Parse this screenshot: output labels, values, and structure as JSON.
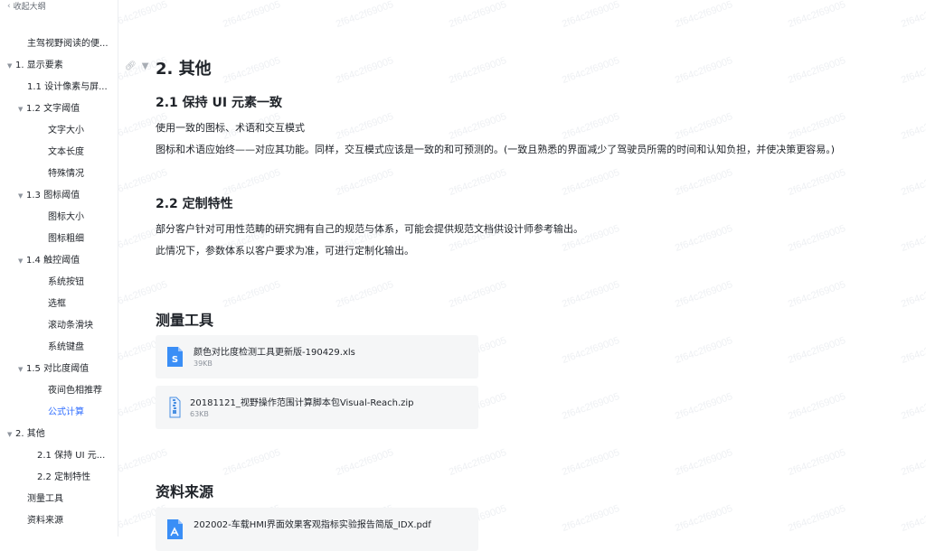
{
  "sidebar": {
    "collapse_label": "收起大纲",
    "toc": [
      {
        "label": "主驾视野阅读的便...",
        "active": false
      },
      {
        "label": "1. 显示要素",
        "active": false
      },
      {
        "label": "1.1 设计像素与屏...",
        "active": false
      },
      {
        "label": "1.2 文字阈值",
        "active": false
      },
      {
        "label": "文字大小",
        "active": false
      },
      {
        "label": "文本长度",
        "active": false
      },
      {
        "label": "特殊情况",
        "active": false
      },
      {
        "label": "1.3 图标阈值",
        "active": false
      },
      {
        "label": "图标大小",
        "active": false
      },
      {
        "label": "图标粗细",
        "active": false
      },
      {
        "label": "1.4 触控阈值",
        "active": false
      },
      {
        "label": "系统按钮",
        "active": false
      },
      {
        "label": "选框",
        "active": false
      },
      {
        "label": "滚动条滑块",
        "active": false
      },
      {
        "label": "系统键盘",
        "active": false
      },
      {
        "label": "1.5 对比度阈值",
        "active": false
      },
      {
        "label": "夜间色相推荐",
        "active": false
      },
      {
        "label": "公式计算",
        "active": true
      },
      {
        "label": "2. 其他",
        "active": false
      },
      {
        "label": "2.1 保持 UI 元...",
        "active": false
      },
      {
        "label": "2.2 定制特性",
        "active": false
      },
      {
        "label": "测量工具",
        "active": false
      },
      {
        "label": "资料来源",
        "active": false
      }
    ]
  },
  "watermark": "2f64c2f69005",
  "content": {
    "section_title": "2. 其他",
    "sub1": {
      "title": "2.1 保持 UI 元素一致",
      "p1": "使用一致的图标、术语和交互模式",
      "p2": "图标和术语应始终——对应其功能。同样，交互模式应该是一致的和可预测的。(一致且熟悉的界面减少了驾驶员所需的时间和认知负担，并使决策更容易。)"
    },
    "sub2": {
      "title": "2.2 定制特性",
      "p1": "部分客户针对可用性范畴的研究拥有自己的规范与体系，可能会提供规范文档供设计师参考输出。",
      "p2": "此情况下，参数体系以客户要求为准，可进行定制化输出。"
    },
    "tools": {
      "title": "测量工具",
      "files": [
        {
          "name": "颜色对比度检测工具更新版-190429.xls",
          "size": "39KB",
          "icon": "spreadsheet-icon"
        },
        {
          "name": "20181121_视野操作范围计算脚本包Visual-Reach.zip",
          "size": "63KB",
          "icon": "zip-icon"
        }
      ]
    },
    "sources": {
      "title": "资料来源",
      "files": [
        {
          "name": "202002-车载HMI界面效果客观指标实验报告简版_IDX.pdf",
          "size": "",
          "icon": "pdf-icon"
        }
      ]
    }
  },
  "colors": {
    "accent": "#3370ff",
    "text": "#1f2329",
    "muted": "#8f959e",
    "card_bg": "#f5f6f7",
    "xls_icon": "#3a8ef6",
    "zip_icon": "#4a90e2",
    "pdf_icon": "#3a8ef6"
  }
}
